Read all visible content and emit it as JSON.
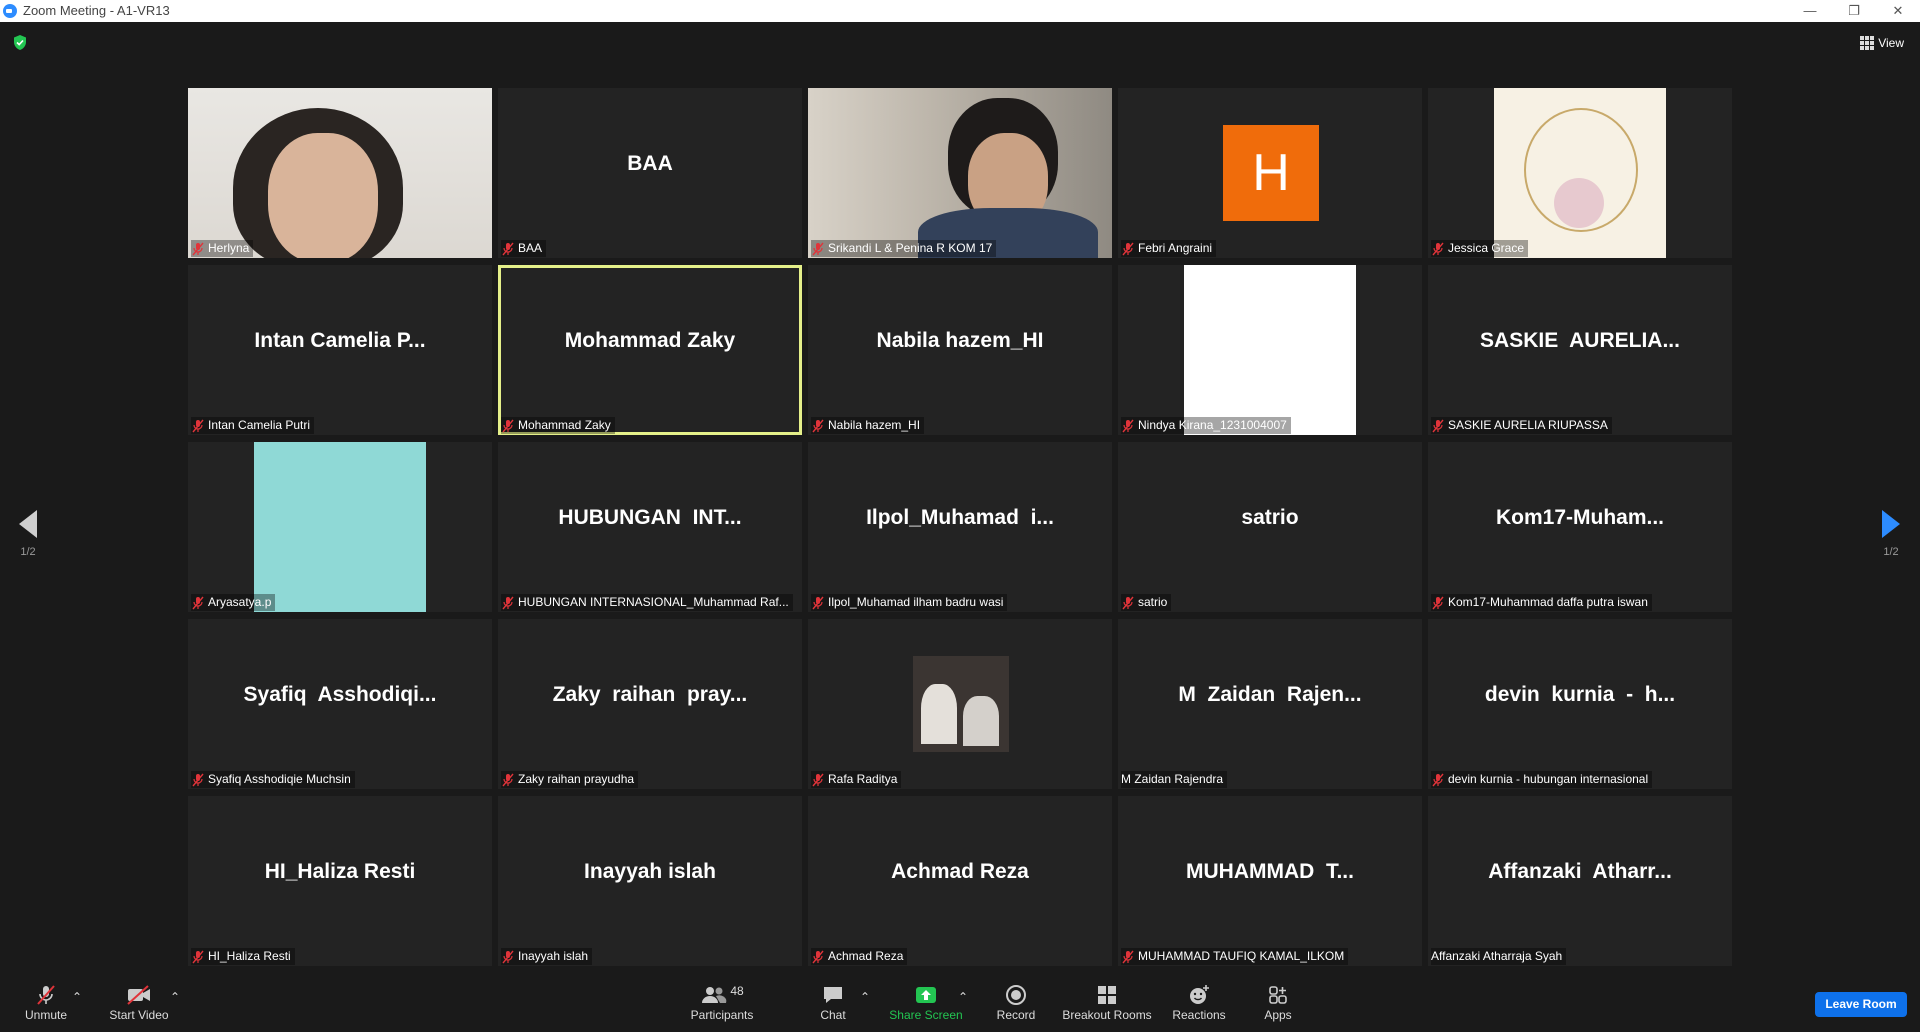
{
  "window": {
    "title": "Zoom Meeting - A1-VR13",
    "minimize": "—",
    "maximize": "❐",
    "close": "✕"
  },
  "top": {
    "view_label": "View"
  },
  "pager": {
    "left": "1/2",
    "right": "1/2"
  },
  "tiles": [
    {
      "name": "Herlyna",
      "center": ""
    },
    {
      "name": "BAA",
      "center": "BAA"
    },
    {
      "name": "Srikandi L & Penina R KOM 17",
      "center": ""
    },
    {
      "name": "Febri Angraini",
      "center": ""
    },
    {
      "name": "Jessica Grace",
      "center": ""
    },
    {
      "name": "Intan Camelia Putri",
      "center": "Intan Camelia P..."
    },
    {
      "name": "Mohammad Zaky",
      "center": "Mohammad Zaky"
    },
    {
      "name": "Nabila hazem_HI",
      "center": "Nabila hazem_HI"
    },
    {
      "name": "Nindya Kirana_1231004007",
      "center": ""
    },
    {
      "name": "SASKIE AURELIA RIUPASSA",
      "center": "SASKIE  AURELIA..."
    },
    {
      "name": "Aryasatya.p",
      "center": ""
    },
    {
      "name": "HUBUNGAN INTERNASIONAL_Muhammad Raf...",
      "center": "HUBUNGAN  INT..."
    },
    {
      "name": "Ilpol_Muhamad ilham badru wasi",
      "center": "Ilpol_Muhamad  i..."
    },
    {
      "name": "satrio",
      "center": "satrio"
    },
    {
      "name": "Kom17-Muhammad daffa putra iswan",
      "center": "Kom17-Muham..."
    },
    {
      "name": "Syafiq Asshodiqie Muchsin",
      "center": "Syafiq  Asshodiqi..."
    },
    {
      "name": "Zaky raihan prayudha",
      "center": "Zaky  raihan  pray..."
    },
    {
      "name": "Rafa Raditya",
      "center": ""
    },
    {
      "name": "M Zaidan Rajendra",
      "center": "M  Zaidan  Rajen..."
    },
    {
      "name": "devin kurnia - hubungan internasional",
      "center": "devin  kurnia  -  h..."
    },
    {
      "name": "HI_Haliza Resti",
      "center": "HI_Haliza Resti"
    },
    {
      "name": "Inayyah islah",
      "center": "Inayyah islah"
    },
    {
      "name": "Achmad Reza",
      "center": "Achmad Reza"
    },
    {
      "name": "MUHAMMAD TAUFIQ KAMAL_ILKOM",
      "center": "MUHAMMAD  T..."
    },
    {
      "name": "Affanzaki Atharraja Syah",
      "center": "Affanzaki  Atharr..."
    }
  ],
  "febri_avatar_letter": "H",
  "toolbar": {
    "unmute": "Unmute",
    "start_video": "Start Video",
    "participants": "Participants",
    "participants_count": "48",
    "chat": "Chat",
    "share_screen": "Share Screen",
    "record": "Record",
    "breakout_rooms": "Breakout Rooms",
    "reactions": "Reactions",
    "apps": "Apps",
    "leave_room": "Leave Room"
  },
  "colors": {
    "accent": "#0e71eb",
    "share": "#23c552",
    "active_border": "#e5f08a",
    "avatar_orange": "#f06c0b",
    "mic_muted": "#e0343a"
  }
}
